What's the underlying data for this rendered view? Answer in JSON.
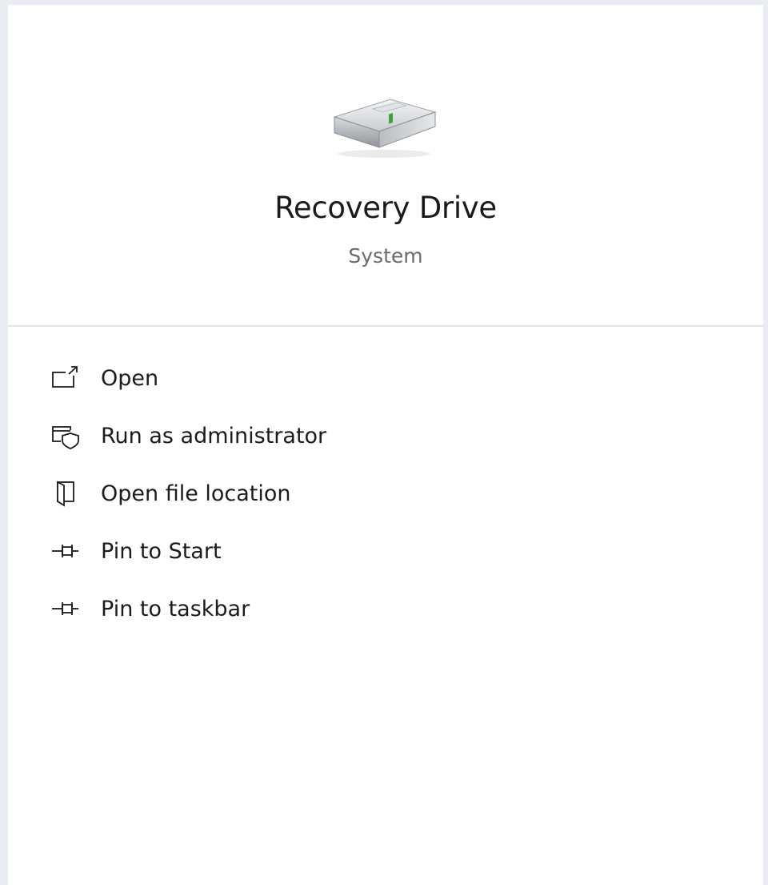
{
  "app": {
    "name": "Recovery Drive",
    "category": "System",
    "icon": "hard-drive-icon"
  },
  "actions": [
    {
      "label": "Open",
      "icon": "open-icon"
    },
    {
      "label": "Run as administrator",
      "icon": "admin-shield-icon"
    },
    {
      "label": "Open file location",
      "icon": "file-location-icon"
    },
    {
      "label": "Pin to Start",
      "icon": "pin-icon"
    },
    {
      "label": "Pin to taskbar",
      "icon": "pin-icon"
    }
  ]
}
